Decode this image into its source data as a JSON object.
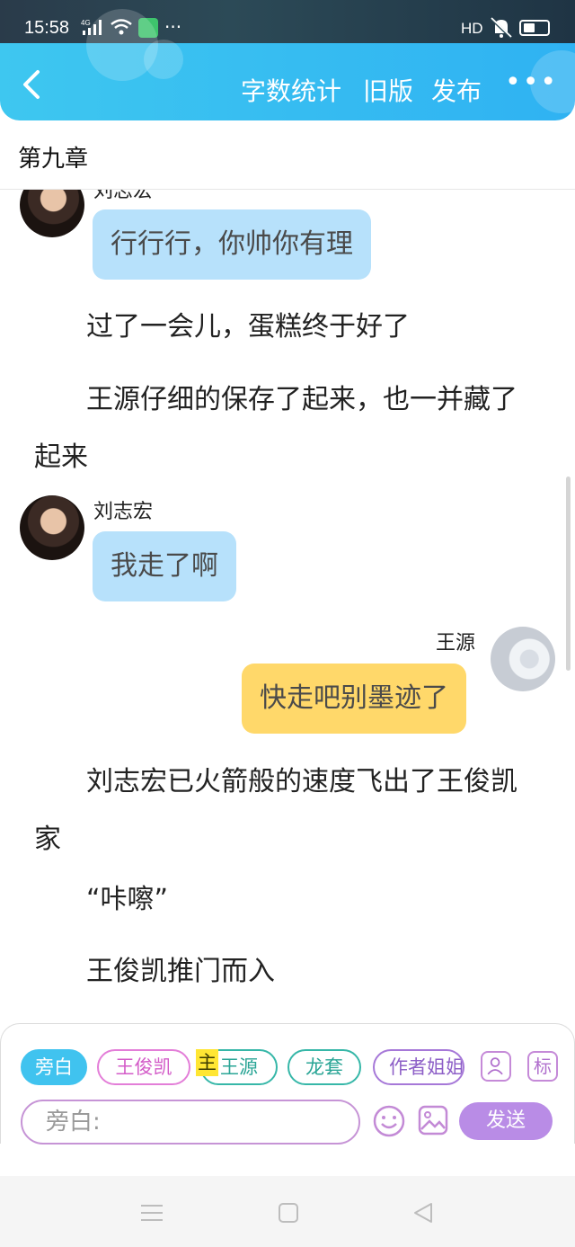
{
  "status_bar": {
    "time": "15:58",
    "network": "4G",
    "hd_label": "HD",
    "more": "···"
  },
  "header": {
    "back_icon": "chevron-left-icon",
    "word_count": "字数统计",
    "old_version": "旧版",
    "publish": "发布",
    "more": "•••"
  },
  "chapter": {
    "title": "第九章"
  },
  "messages": [
    {
      "type": "bubble",
      "side": "left",
      "speaker": "刘志宏",
      "text": "行行行，你帅你有理",
      "color": "#b7e1fb"
    },
    {
      "type": "narration",
      "text": "过了一会儿，蛋糕终于好了"
    },
    {
      "type": "narration",
      "text": "王源仔细的保存了起来，也一并藏了起来"
    },
    {
      "type": "bubble",
      "side": "left",
      "speaker": "刘志宏",
      "text": "我走了啊",
      "color": "#b7e1fb"
    },
    {
      "type": "bubble",
      "side": "right",
      "speaker": "王源",
      "text": "快走吧别墨迹了",
      "color": "#ffd86a"
    },
    {
      "type": "narration",
      "text": "刘志宏已火箭般的速度飞出了王俊凯家"
    },
    {
      "type": "narration",
      "text": "“咔嚓”"
    },
    {
      "type": "narration",
      "text": "王俊凯推门而入"
    }
  ],
  "composer": {
    "roles": [
      {
        "label": "旁白",
        "style": "active"
      },
      {
        "label": "王俊凯",
        "style": "pink"
      },
      {
        "label": "王源",
        "style": "teal"
      },
      {
        "label": "龙套",
        "style": "teal"
      },
      {
        "label": "作者姐姐",
        "style": "purple"
      }
    ],
    "main_marker": "主",
    "mark_button": "标",
    "input_placeholder": "旁白:",
    "send_label": "发送"
  },
  "colors": {
    "header_blue": "#3ec7f0",
    "bubble_blue": "#b7e1fb",
    "bubble_yellow": "#ffd86a",
    "send_purple": "#b98ce6"
  }
}
